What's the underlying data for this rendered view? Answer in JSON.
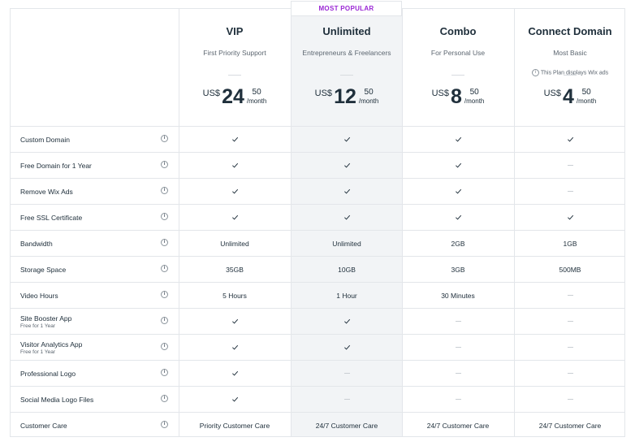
{
  "badge": "MOST POPULAR",
  "currency": "US$",
  "per_label": "/month",
  "plans": [
    {
      "name": "VIP",
      "desc": "First Priority Support",
      "note": "",
      "price_whole": "24",
      "price_cents": "50"
    },
    {
      "name": "Unlimited",
      "desc": "Entrepreneurs & Freelancers",
      "note": "",
      "price_whole": "12",
      "price_cents": "50"
    },
    {
      "name": "Combo",
      "desc": "For Personal Use",
      "note": "",
      "price_whole": "8",
      "price_cents": "50"
    },
    {
      "name": "Connect Domain",
      "desc": "Most Basic",
      "note": "This Plan displays Wix ads",
      "price_whole": "4",
      "price_cents": "50"
    }
  ],
  "features": [
    {
      "label": "Custom Domain",
      "sub": "",
      "values": [
        "check",
        "check",
        "check",
        "check"
      ]
    },
    {
      "label": "Free Domain for 1 Year",
      "sub": "",
      "values": [
        "check",
        "check",
        "check",
        "dash"
      ]
    },
    {
      "label": "Remove Wix Ads",
      "sub": "",
      "values": [
        "check",
        "check",
        "check",
        "dash"
      ]
    },
    {
      "label": "Free SSL Certificate",
      "sub": "",
      "values": [
        "check",
        "check",
        "check",
        "check"
      ]
    },
    {
      "label": "Bandwidth",
      "sub": "",
      "values": [
        "Unlimited",
        "Unlimited",
        "2GB",
        "1GB"
      ]
    },
    {
      "label": "Storage Space",
      "sub": "",
      "values": [
        "35GB",
        "10GB",
        "3GB",
        "500MB"
      ]
    },
    {
      "label": "Video Hours",
      "sub": "",
      "values": [
        "5 Hours",
        "1 Hour",
        "30 Minutes",
        "dash"
      ]
    },
    {
      "label": "Site Booster App",
      "sub": "Free for 1 Year",
      "values": [
        "check",
        "check",
        "dash",
        "dash"
      ]
    },
    {
      "label": "Visitor Analytics App",
      "sub": "Free for 1 Year",
      "values": [
        "check",
        "check",
        "dash",
        "dash"
      ]
    },
    {
      "label": "Professional Logo",
      "sub": "",
      "values": [
        "check",
        "dash",
        "dash",
        "dash"
      ]
    },
    {
      "label": "Social Media Logo Files",
      "sub": "",
      "values": [
        "check",
        "dash",
        "dash",
        "dash"
      ]
    },
    {
      "label": "Customer Care",
      "sub": "",
      "values": [
        "Priority Customer Care",
        "24/7 Customer Care",
        "24/7 Customer Care",
        "24/7 Customer Care"
      ]
    }
  ],
  "colors": {
    "accent": "#9a27d5",
    "highlight_bg": "#f2f4f6",
    "border": "#e3e6ea",
    "text": "#20303c"
  }
}
